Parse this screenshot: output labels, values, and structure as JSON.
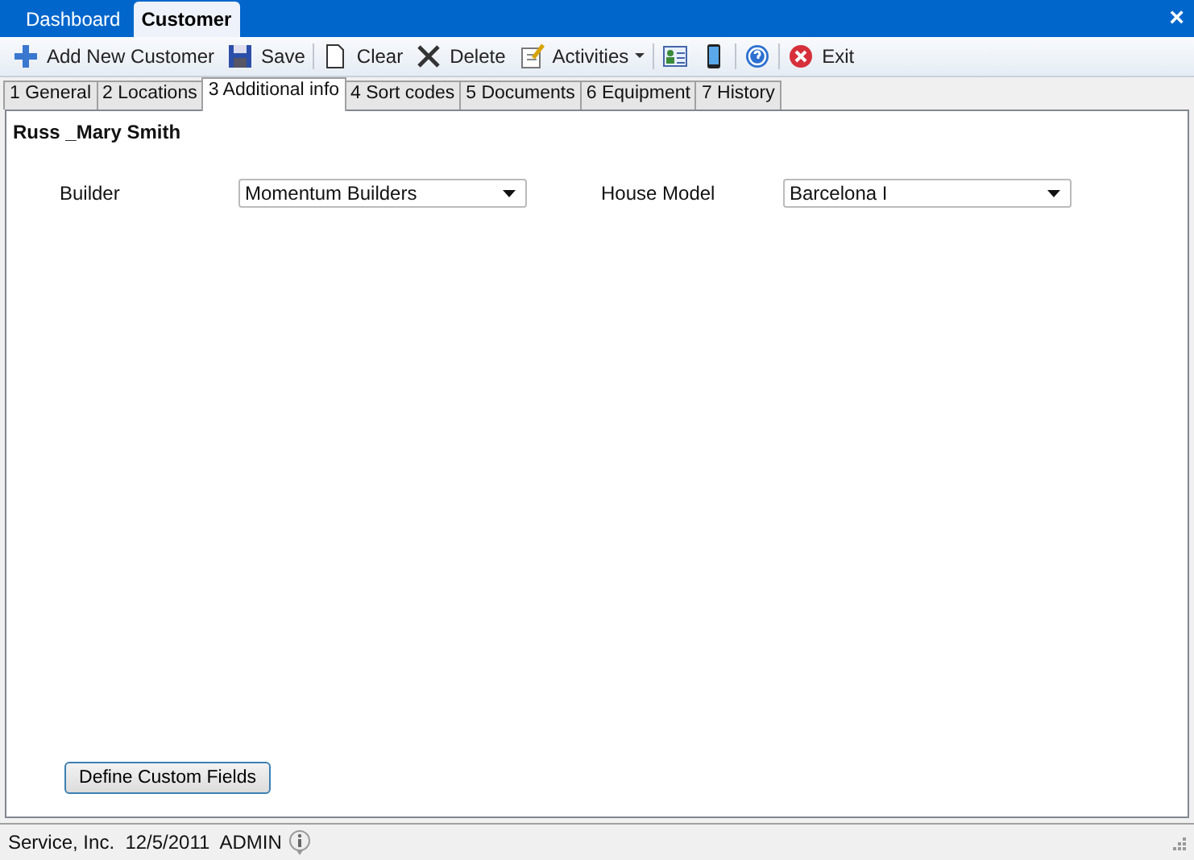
{
  "window": {
    "close": "×"
  },
  "top_tabs": [
    {
      "label": "Dashboard",
      "selected": false
    },
    {
      "label": "Customer",
      "selected": true
    }
  ],
  "toolbar": [
    {
      "kind": "button",
      "label": "Add New Customer"
    },
    {
      "kind": "button",
      "label": "Save"
    },
    {
      "kind": "separator"
    },
    {
      "kind": "button",
      "label": "Clear"
    },
    {
      "kind": "button",
      "label": "Delete"
    },
    {
      "kind": "dropdown",
      "label": "Activities"
    },
    {
      "kind": "separator"
    },
    {
      "kind": "icon"
    },
    {
      "kind": "icon"
    },
    {
      "kind": "separator"
    },
    {
      "kind": "icon"
    },
    {
      "kind": "separator"
    },
    {
      "kind": "button",
      "label": "Exit"
    }
  ],
  "tabs": [
    {
      "label": "1 General",
      "selected": false
    },
    {
      "label": "2 Locations",
      "selected": false
    },
    {
      "label": "3 Additional info",
      "selected": true
    },
    {
      "label": "4 Sort codes",
      "selected": false
    },
    {
      "label": "5 Documents",
      "selected": false
    },
    {
      "label": "6 Equipment",
      "selected": false
    },
    {
      "label": "7 History",
      "selected": false
    }
  ],
  "customer_name": "Russ _Mary Smith",
  "fields": [
    {
      "label": "Builder",
      "value": "Momentum Builders"
    },
    {
      "label": "House Model",
      "value": "Barcelona I"
    }
  ],
  "define_button": "Define Custom Fields",
  "status_bar": {
    "text": "Service, Inc.  12/5/2011  ADMIN"
  }
}
